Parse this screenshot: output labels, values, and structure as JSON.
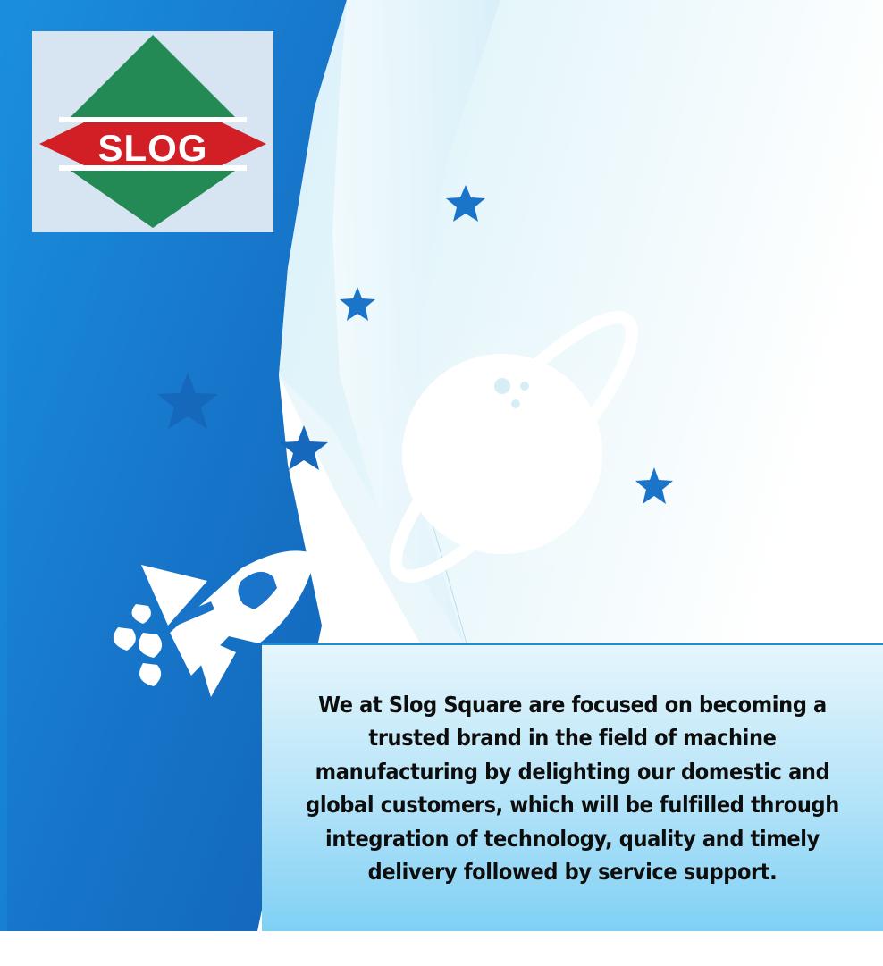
{
  "logo": {
    "text": "SLOG",
    "icon": "slog-diamond-logo",
    "colors": {
      "green": "#238a55",
      "red": "#d21f26",
      "background": "#d7e5f2"
    }
  },
  "mission": {
    "text": "We at Slog Square are focused on becoming a trusted brand in the field of machine manufacturing by delighting our domestic and global customers, which will be fulfilled through integration of technology, quality and timely delivery followed by service support."
  },
  "decor": {
    "icons": [
      "star-icon",
      "planet-icon",
      "rocket-icon"
    ],
    "colors": {
      "blue_panel": "#1273c8",
      "light_panel": "#e3f5fb",
      "star": "#1a74c9"
    }
  }
}
